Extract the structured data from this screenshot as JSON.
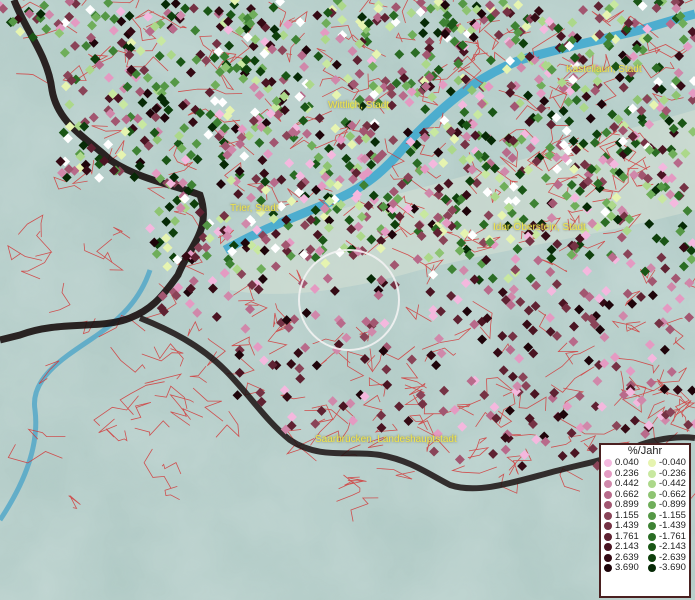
{
  "map": {
    "cities": [
      {
        "name": "Kastellaun, Stadt"
      },
      {
        "name": "Wittlich, Stadt"
      },
      {
        "name": "Trier, Stadt"
      },
      {
        "name": "Idar-Oberstein, Stadt"
      },
      {
        "name": "Saarbrücken, Landeshauptstadt"
      }
    ]
  },
  "legend": {
    "title": "%/Jahr",
    "positive": [
      {
        "label": "0.040",
        "color": "#f4b8de"
      },
      {
        "label": "0.236",
        "color": "#e49ac2"
      },
      {
        "label": "0.442",
        "color": "#d088aa"
      },
      {
        "label": "0.662",
        "color": "#b86a8a"
      },
      {
        "label": "0.899",
        "color": "#a25670"
      },
      {
        "label": "1.155",
        "color": "#8a4458"
      },
      {
        "label": "1.439",
        "color": "#753244"
      },
      {
        "label": "1.761",
        "color": "#5f2232"
      },
      {
        "label": "2.143",
        "color": "#4a1422"
      },
      {
        "label": "2.639",
        "color": "#340a14"
      },
      {
        "label": "3.690",
        "color": "#1e040a"
      }
    ],
    "negative": [
      {
        "label": "-0.040",
        "color": "#e6f4b0"
      },
      {
        "label": "-0.236",
        "color": "#c8e8a0"
      },
      {
        "label": "-0.442",
        "color": "#acd88a"
      },
      {
        "label": "-0.662",
        "color": "#8ec472"
      },
      {
        "label": "-0.899",
        "color": "#6fae5a"
      },
      {
        "label": "-1.155",
        "color": "#559846"
      },
      {
        "label": "-1.439",
        "color": "#3e8234"
      },
      {
        "label": "-1.761",
        "color": "#2a6c24"
      },
      {
        "label": "-2.143",
        "color": "#1a5616"
      },
      {
        "label": "-2.639",
        "color": "#0e400c"
      },
      {
        "label": "-3.690",
        "color": "#062a06"
      }
    ]
  }
}
